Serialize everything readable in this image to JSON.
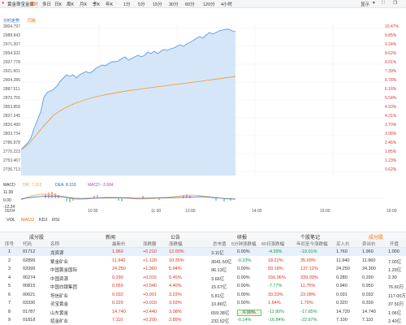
{
  "toolbar": {
    "title": "黄金珠宝金属",
    "periods": [
      "分时",
      "多日",
      "日K",
      "周K",
      "月K",
      "季K",
      "年K",
      "1分",
      "5分",
      "15分",
      "30分",
      "60分",
      "120分",
      "4小时"
    ],
    "active_period": "分时",
    "search_hint": "搜",
    "settings_label": "显示"
  },
  "sub": {
    "left": "分时走势",
    "tab": "同板"
  },
  "y_left": [
    "3004.797",
    "2988.843",
    "2971.207",
    "2954.932",
    "2937.778",
    "2921.601",
    "2904.286",
    "2887.511",
    "2870.755",
    "2853.858",
    "2837.245",
    "2820.490",
    "2803.734",
    "2786.978",
    "2770.223",
    "2753.467",
    "2736.713"
  ],
  "y_right": [
    "10.47%",
    "9.85%",
    "9.24%",
    "8.62%",
    "8.01%",
    "7.39%",
    "6.78%",
    "6.16%",
    "5.54%",
    "4.93%",
    "4.31%",
    "3.70%",
    "3.08%",
    "2.46%",
    "1.85%",
    "1.23%",
    "0.62%"
  ],
  "chart_series_colors": {
    "price": "#5a9be0",
    "average": "#f0a040",
    "fill": "#cfe2f8"
  },
  "macd": {
    "label": "MACD",
    "dif": "DIF: 7.312",
    "dea": "DEA: 8.153",
    "macd": "MACD: -3.684",
    "scale_top": "11.00",
    "scale_mid": "0.00",
    "scale_bot": "-12.24"
  },
  "time_axis": [
    "09:30",
    "10:30",
    "11:30",
    "13:00",
    "14:00",
    "15:00"
  ],
  "time_axis_right": "16:00",
  "date_label": "05/04",
  "bottom_tabs": [
    "VOL",
    "MACD",
    "KDJ",
    "RSI"
  ],
  "active_bottom_tab": "MACD",
  "section": {
    "tabs": [
      "成分股",
      "新闻",
      "公告",
      "研报",
      "个股笔记"
    ],
    "active_tab": "成分股",
    "more_icon": "ellipsis-icon",
    "menu_label": "显示",
    "columns_label": "设置"
  },
  "columns": [
    "序号",
    "代码",
    "名称",
    "",
    "最新价",
    "涨跌额",
    "涨跌幅",
    "总市值",
    "5分钟涨跌幅",
    "60日涨跌幅",
    "年初至今涨跌幅",
    "买入价",
    "卖出价",
    "开盘"
  ],
  "rows": [
    {
      "n": "1",
      "code": "01712",
      "name": "龙资源",
      "price": "1.960",
      "chg": "+0.210",
      "pct": "12.00%",
      "cap": "3.11亿",
      "m5": "0.00%",
      "d60": "-4.39%",
      "ytd": "-19.01%",
      "bid": "1.760",
      "ask": "1.960",
      "open": "1.000",
      "dir": "up",
      "d60dir": "down",
      "ytddir": "down"
    },
    {
      "n": "2",
      "code": "02899",
      "name": "紫金矿业",
      "price": "11.940",
      "chg": "+1.120",
      "pct": "10.35%",
      "cap": "3041.50亿",
      "m5": "-0.33%",
      "d60": "18.22%",
      "ytd": "35.99%",
      "bid": "11.940",
      "ask": "11.960",
      "open": "7.00亿",
      "dir": "up",
      "d60dir": "up",
      "ytddir": "up"
    },
    {
      "n": "3",
      "code": "02099",
      "name": "中国黄金国际",
      "price": "24.250",
      "chg": "+1.360",
      "pct": "5.94%",
      "cap": "96.13亿",
      "m5": "0.00%",
      "d60": "50.18%",
      "ytd": "137.12%",
      "bid": "24.250",
      "ask": "24.300",
      "open": "1.29亿",
      "dir": "up",
      "d60dir": "up",
      "ytddir": "up"
    },
    {
      "n": "4",
      "code": "00274",
      "name": "中国资源",
      "price": "0.290",
      "chg": "+0.015",
      "pct": "5.45%",
      "cap": "3.66亿",
      "m5": "0.00%",
      "d60": "166.06%",
      "ytd": "339.39%",
      "bid": "0.280",
      "ask": "0.290",
      "open": "2.30",
      "dir": "up",
      "d60dir": "up",
      "ytddir": "up"
    },
    {
      "n": "5",
      "code": "00815",
      "name": "中国白银集团",
      "price": "0.950",
      "chg": "+0.040",
      "pct": "4.40%",
      "cap": "15.67亿",
      "m5": "0.00%",
      "d60": "-7.77%",
      "ytd": "11.76%",
      "bid": "0.940",
      "ask": "0.950",
      "open": "76.60万",
      "dir": "up",
      "d60dir": "down",
      "ytddir": "up"
    },
    {
      "n": "6",
      "code": "00621",
      "name": "坦信矿业",
      "price": "0.032",
      "chg": "+0.001",
      "pct": "3.23%",
      "cap": "5.81亿",
      "m5": "0.00%",
      "d60": "33.33%",
      "ytd": "23.08%",
      "bid": "0.031",
      "ask": "0.032",
      "open": "117.00万",
      "dir": "up",
      "d60dir": "up",
      "ytddir": "up"
    },
    {
      "n": "7",
      "code": "03330",
      "name": "灵宝黄金",
      "price": "0.320",
      "chg": "+0.010",
      "pct": "3.03%",
      "cap": "10.86亿",
      "m5": "0.00%",
      "d60": "1.64%",
      "ytd": "1.79%",
      "bid": "0.320",
      "ask": "0.330",
      "open": "37.50万",
      "dir": "up",
      "d60dir": "up",
      "ytddir": "up"
    },
    {
      "n": "8",
      "code": "01787",
      "name": "山东黄金",
      "price": "14.740",
      "chg": "+0.440",
      "pct": "3.08%",
      "cap": "659.38亿",
      "m5": "0.00%",
      "d60": "-11.95%",
      "ytd": "-17.65%",
      "bid": "14.720",
      "ask": "14.740",
      "open": "1.06亿",
      "dir": "up",
      "d60dir": "down",
      "ytddir": "down"
    },
    {
      "n": "9",
      "code": "01818",
      "name": "招金矿业",
      "price": "7.110",
      "chg": "+0.200",
      "pct": "2.89%",
      "cap": "232.52亿",
      "m5": "-0.14%",
      "d60": "-16.84%",
      "ytd": "-22.97%",
      "bid": "7.100",
      "ask": "7.110",
      "open": "2.40亿",
      "dir": "up",
      "d60dir": "down",
      "ytddir": "down"
    }
  ]
}
